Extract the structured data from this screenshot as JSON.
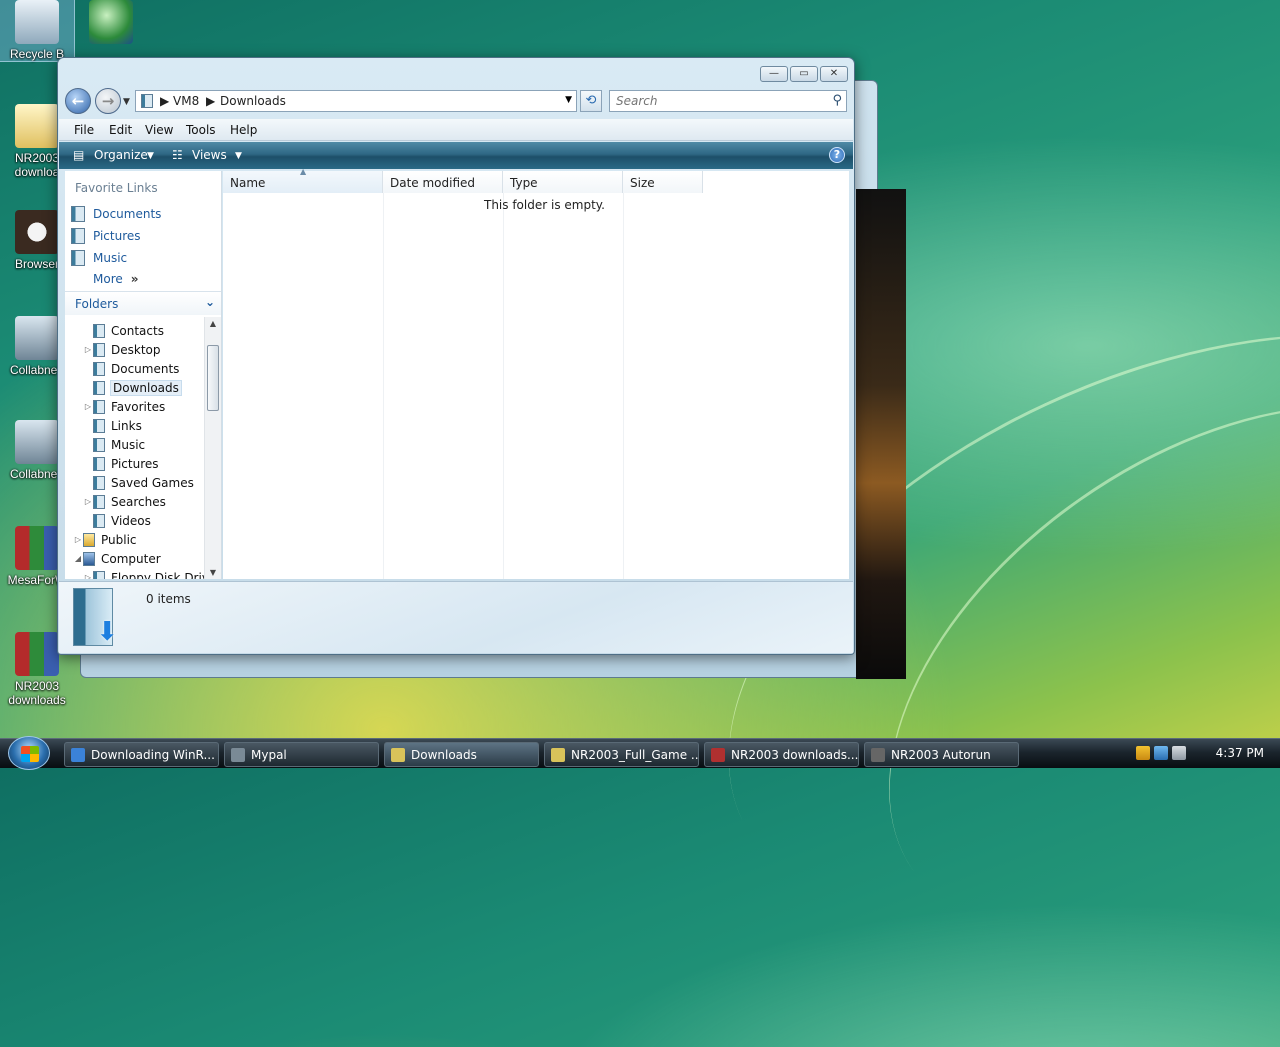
{
  "desktop": {
    "icons": [
      {
        "label": "Recycle B",
        "icon": "recycle-bin-icon"
      },
      {
        "label": "",
        "icon": "network-globe-icon"
      },
      {
        "label": "NR2003 downloa",
        "icon": "folder-icon"
      },
      {
        "label": "Browser",
        "icon": "raccoon-browser-icon"
      },
      {
        "label": "CollabnetI",
        "icon": "computer-icon"
      },
      {
        "label": "CollabnetI",
        "icon": "computer-icon"
      },
      {
        "label": "MesaForW",
        "icon": "winrar-archive-icon"
      },
      {
        "label": "NR2003 downloads",
        "icon": "winrar-archive-icon"
      }
    ]
  },
  "window": {
    "caption_buttons": {
      "minimize": "—",
      "maximize": "▭",
      "close": "✕"
    },
    "address": {
      "root_icon": "computer-small-icon",
      "crumbs": [
        "VM8",
        "Downloads"
      ],
      "separator": "▶"
    },
    "search": {
      "placeholder": "Search"
    },
    "menu": [
      "File",
      "Edit",
      "View",
      "Tools",
      "Help"
    ],
    "commandbar": {
      "organize": "Organize",
      "views": "Views",
      "help": "?"
    },
    "navpane": {
      "favorites_header": "Favorite Links",
      "favorites": [
        "Documents",
        "Pictures",
        "Music"
      ],
      "more": "More",
      "more_glyph": "»",
      "folders_header": "Folders",
      "tree": [
        {
          "label": "Contacts",
          "expander": "",
          "depth": 1
        },
        {
          "label": "Desktop",
          "expander": "▷",
          "depth": 1
        },
        {
          "label": "Documents",
          "expander": "",
          "depth": 1
        },
        {
          "label": "Downloads",
          "expander": "",
          "depth": 1,
          "selected": true
        },
        {
          "label": "Favorites",
          "expander": "▷",
          "depth": 1
        },
        {
          "label": "Links",
          "expander": "",
          "depth": 1
        },
        {
          "label": "Music",
          "expander": "",
          "depth": 1
        },
        {
          "label": "Pictures",
          "expander": "",
          "depth": 1
        },
        {
          "label": "Saved Games",
          "expander": "",
          "depth": 1
        },
        {
          "label": "Searches",
          "expander": "▷",
          "depth": 1
        },
        {
          "label": "Videos",
          "expander": "",
          "depth": 1
        },
        {
          "label": "Public",
          "expander": "▷",
          "depth": 0
        },
        {
          "label": "Computer",
          "expander": "◢",
          "depth": 0
        },
        {
          "label": "Floppy Disk Drive",
          "expander": "▷",
          "depth": 1
        }
      ]
    },
    "columns": [
      "Name",
      "Date modified",
      "Type",
      "Size"
    ],
    "empty_message": "This folder is empty.",
    "details": {
      "item_count": "0 items"
    }
  },
  "taskbar": {
    "buttons": [
      {
        "label": "Downloading WinR...",
        "color": "#3b82d8"
      },
      {
        "label": "Mypal",
        "color": "#7a8a96"
      },
      {
        "label": "Downloads",
        "color": "#d9c35a"
      },
      {
        "label": "NR2003_Full_Game ...",
        "color": "#d9c35a"
      },
      {
        "label": "NR2003 downloads....",
        "color": "#b03030"
      },
      {
        "label": "NR2003 Autorun",
        "color": "#666666"
      }
    ],
    "clock": "4:37 PM"
  }
}
